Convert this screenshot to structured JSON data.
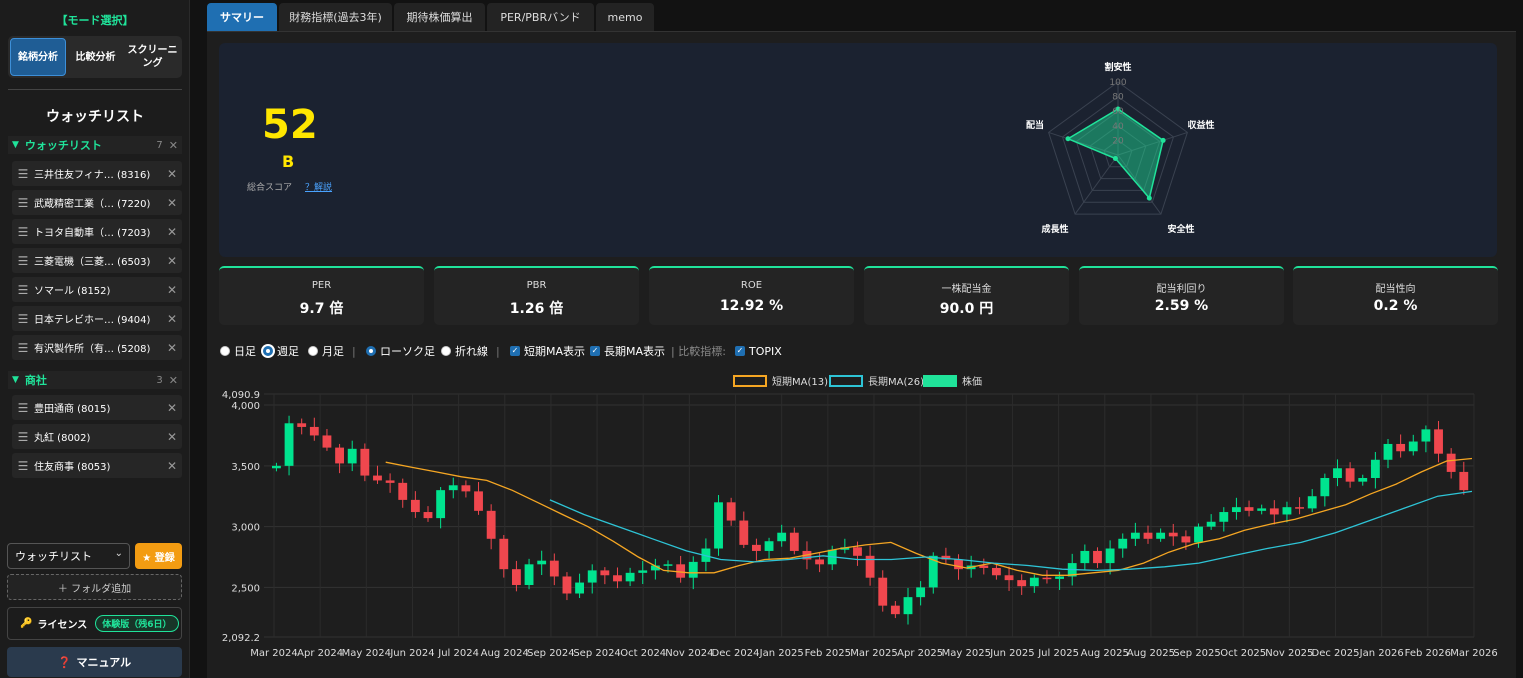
{
  "sidebar": {
    "mode_title": "【モード選択】",
    "modes": [
      "銘柄分析",
      "比較分析",
      "スクリーニング"
    ],
    "watchlist_title": "ウォッチリスト",
    "groups": [
      {
        "name": "ウォッチリスト",
        "count": "7",
        "items": [
          "三井住友フィナ… (8316)",
          "武蔵精密工業（… (7220)",
          "トヨタ自動車（… (7203)",
          "三菱電機（三菱… (6503)",
          "ソマール (8152)",
          "日本テレビホー… (9404)",
          "有沢製作所（有… (5208)"
        ]
      },
      {
        "name": "商社",
        "count": "3",
        "items": [
          "豊田通商 (8015)",
          "丸紅 (8002)",
          "住友商事 (8053)"
        ]
      }
    ],
    "select_value": "ウォッチリスト",
    "register_label": "★ 登録",
    "add_folder_label": "＋ フォルダ追加",
    "license_label": "ライセンス",
    "license_badge": "体験版（残6日）",
    "manual_label": "マニュアル"
  },
  "tabs": [
    "サマリー",
    "財務指標(過去3年)",
    "期待株価算出",
    "PER/PBRバンド",
    "memo"
  ],
  "score": {
    "value": "52",
    "grade": "B",
    "label": "総合スコア",
    "help": "？解説"
  },
  "radar": {
    "axes": [
      "割安性",
      "収益性",
      "安全性",
      "成長性",
      "配当"
    ],
    "values": [
      63,
      65,
      73,
      6,
      72
    ],
    "ticks": [
      "100",
      "80",
      "60",
      "40",
      "20"
    ]
  },
  "metrics": [
    {
      "label": "PER",
      "value": "9.7 倍"
    },
    {
      "label": "PBR",
      "value": "1.26 倍"
    },
    {
      "label": "ROE",
      "value": "12.92 %"
    },
    {
      "label": "一株配当金",
      "value": "90.0 円"
    },
    {
      "label": "配当利回り",
      "value": "2.59 %"
    },
    {
      "label": "配当性向",
      "value": "0.2 %"
    }
  ],
  "controls": {
    "daily": "日足",
    "weekly": "週足",
    "monthly": "月足",
    "candle": "ローソク足",
    "line": "折れ線",
    "short_ma": "短期MA表示",
    "long_ma": "長期MA表示",
    "compare_label": "比較指標:",
    "topix": "TOPIX"
  },
  "chart_data": {
    "type": "candlestick",
    "legend": [
      "短期MA(13)",
      "長期MA(26)",
      "株価"
    ],
    "ylim": [
      2092.2,
      4090.9
    ],
    "y_ticks": [
      "4,090.9",
      "4,000",
      "3,500",
      "3,000",
      "2,500",
      "2,092.2"
    ],
    "x_labels": [
      "Mar 2024",
      "Apr 2024",
      "May 2024",
      "Jun 2024",
      "Jul 2024",
      "Aug 2024",
      "Sep 2024",
      "Sep 2024",
      "Oct 2024",
      "Nov 2024",
      "Dec 2024",
      "Jan 2025",
      "Feb 2025",
      "Mar 2025",
      "Apr 2025",
      "May 2025",
      "Jun 2025",
      "Jul 2025",
      "Aug 2025",
      "Aug 2025",
      "Sep 2025",
      "Oct 2025",
      "Nov 2025",
      "Dec 2025",
      "Jan 2026",
      "Feb 2026",
      "Mar 2026"
    ],
    "close": [
      3500,
      3850,
      3820,
      3750,
      3650,
      3520,
      3640,
      3420,
      3380,
      3360,
      3220,
      3120,
      3070,
      3300,
      3340,
      3290,
      3130,
      2900,
      2650,
      2520,
      2690,
      2720,
      2590,
      2450,
      2540,
      2640,
      2600,
      2550,
      2620,
      2640,
      2680,
      2690,
      2580,
      2710,
      2820,
      3200,
      3050,
      2850,
      2800,
      2880,
      2950,
      2800,
      2730,
      2690,
      2810,
      2830,
      2760,
      2580,
      2350,
      2280,
      2420,
      2500,
      2760,
      2730,
      2650,
      2680,
      2660,
      2600,
      2560,
      2510,
      2580,
      2570,
      2590,
      2700,
      2800,
      2700,
      2820,
      2900,
      2950,
      2900,
      2950,
      2920,
      2870,
      3000,
      3040,
      3120,
      3160,
      3130,
      3150,
      3100,
      3160,
      3150,
      3250,
      3400,
      3480,
      3370,
      3400,
      3550,
      3680,
      3620,
      3700,
      3800,
      3600,
      3450,
      3300
    ],
    "short_ma_13": [
      3530,
      3490,
      3450,
      3410,
      3380,
      3300,
      3200,
      3100,
      3000,
      2880,
      2750,
      2640,
      2620,
      2620,
      2680,
      2730,
      2740,
      2780,
      2820,
      2850,
      2870,
      2780,
      2700,
      2660,
      2700,
      2640,
      2600,
      2600,
      2620,
      2640,
      2700,
      2790,
      2860,
      2900,
      2970,
      3020,
      3060,
      3120,
      3180,
      3270,
      3350,
      3450,
      3540,
      3560
    ],
    "long_ma_26": [
      3220,
      3100,
      3000,
      2900,
      2800,
      2730,
      2710,
      2730,
      2760,
      2730,
      2730,
      2750,
      2730,
      2700,
      2680,
      2650,
      2640,
      2650,
      2670,
      2700,
      2760,
      2820,
      2870,
      2950,
      3050,
      3150,
      3250,
      3290
    ]
  }
}
